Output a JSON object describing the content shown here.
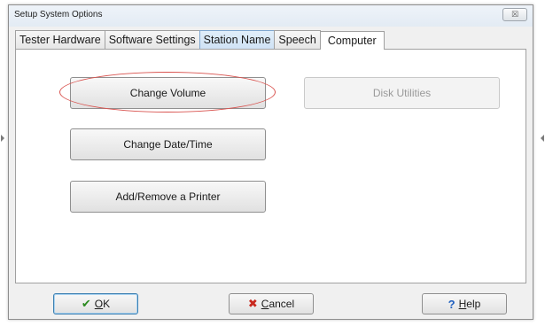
{
  "window": {
    "title": "Setup System Options",
    "close_symbol": "☒"
  },
  "tabs": [
    {
      "label": "Tester Hardware"
    },
    {
      "label": "Software Settings"
    },
    {
      "label": "Station Name"
    },
    {
      "label": "Speech"
    },
    {
      "label": "Computer"
    }
  ],
  "active_tab": "Computer",
  "panel": {
    "change_volume": "Change Volume",
    "disk_utilities": "Disk Utilities",
    "change_datetime": "Change Date/Time",
    "add_remove_printer": "Add/Remove a Printer"
  },
  "footer": {
    "ok": {
      "icon": "✔",
      "mnemonic": "O",
      "rest": "K"
    },
    "cancel": {
      "icon": "✖",
      "mnemonic": "C",
      "rest": "ancel"
    },
    "help": {
      "icon": "?",
      "mnemonic": "H",
      "rest": "elp"
    }
  },
  "colors": {
    "annotation_ellipse": "#d9534f",
    "ok_icon": "#2a8a1f",
    "cancel_icon": "#c8281e",
    "help_icon": "#1f5fbf"
  }
}
